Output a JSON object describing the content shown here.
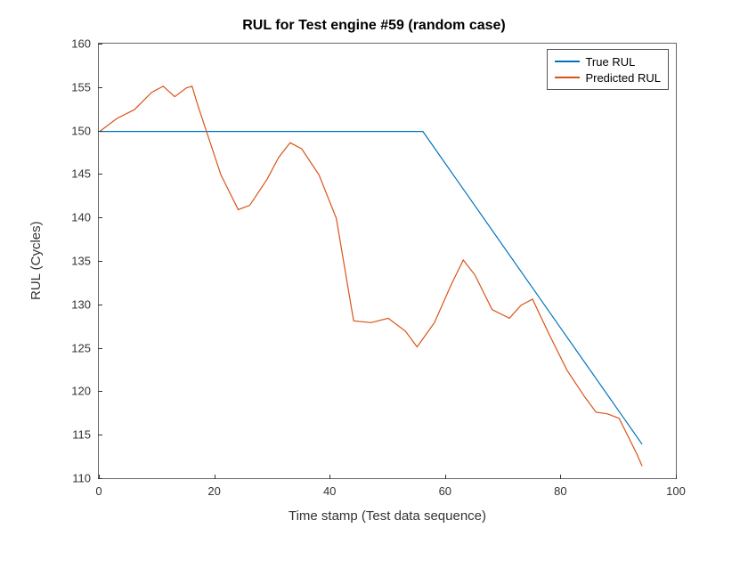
{
  "chart_data": {
    "type": "line",
    "title": "RUL for Test engine #59 (random case)",
    "xlabel": "Time stamp (Test data sequence)",
    "ylabel": "RUL (Cycles)",
    "xlim": [
      0,
      100
    ],
    "ylim": [
      110,
      160
    ],
    "xticks": [
      0,
      20,
      40,
      60,
      80,
      100
    ],
    "yticks": [
      110,
      115,
      120,
      125,
      130,
      135,
      140,
      145,
      150,
      155,
      160
    ],
    "legend_position": "top-right",
    "series": [
      {
        "name": "True RUL",
        "color": "#0072BD",
        "x": [
          0,
          56,
          94
        ],
        "y": [
          150,
          150,
          114
        ]
      },
      {
        "name": "Predicted RUL",
        "color": "#D95319",
        "x": [
          0,
          3,
          6,
          9,
          11,
          13,
          15,
          16,
          17,
          19,
          21,
          24,
          26,
          29,
          31,
          33,
          35,
          38,
          41,
          44,
          47,
          50,
          53,
          55,
          58,
          61,
          63,
          65,
          68,
          71,
          73,
          75,
          78,
          81,
          84,
          86,
          88,
          90,
          93,
          94
        ],
        "y": [
          150,
          151.5,
          152.5,
          154.5,
          155.2,
          154.0,
          155.0,
          155.2,
          153.0,
          149.0,
          145.0,
          141.0,
          141.5,
          144.5,
          147.0,
          148.7,
          148.0,
          145.0,
          140.0,
          128.2,
          128.0,
          128.5,
          127.0,
          125.2,
          128.0,
          132.5,
          135.2,
          133.5,
          129.5,
          128.5,
          130.0,
          130.7,
          126.5,
          122.5,
          119.5,
          117.7,
          117.5,
          117.0,
          113.0,
          111.5
        ]
      }
    ]
  }
}
